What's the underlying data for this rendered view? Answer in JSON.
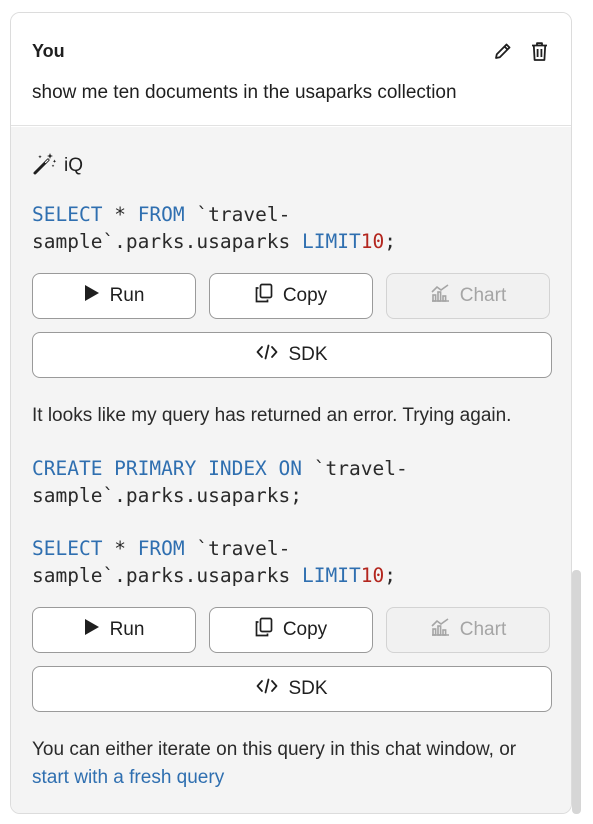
{
  "user": {
    "name": "You",
    "message": "show me ten documents in the usaparks collection"
  },
  "assistant": {
    "name": "iQ",
    "query1": {
      "kw1": "SELECT",
      "star": " * ",
      "kw2": "FROM",
      "rest_line1": " `travel-",
      "line2": "sample`.parks.usaparks ",
      "kw3": "LIMIT",
      "num": "10",
      "end": ";"
    },
    "buttons1": {
      "run": "Run",
      "copy": "Copy",
      "chart": "Chart",
      "sdk": "SDK"
    },
    "error_text": "It looks like my query has returned an error. Trying again.",
    "query2": {
      "kw1": "CREATE PRIMARY INDEX ON",
      "rest_line1": " `travel-",
      "line2": "sample`.parks.usaparks;"
    },
    "query3": {
      "kw1": "SELECT",
      "star": " * ",
      "kw2": "FROM",
      "rest_line1": " `travel-",
      "line2": "sample`.parks.usaparks ",
      "kw3": "LIMIT",
      "num": "10",
      "end": ";"
    },
    "buttons2": {
      "run": "Run",
      "copy": "Copy",
      "chart": "Chart",
      "sdk": "SDK"
    },
    "footer_text": "You can either iterate on this query in this chat window, or",
    "footer_link": "start with a fresh query"
  },
  "colors": {
    "keyword": "#2f6fb0",
    "number": "#b3261e",
    "link": "#2f6fb0",
    "panel_bg": "#f4f4f4"
  },
  "icons": [
    "pencil-icon",
    "trash-icon",
    "magic-wand-icon",
    "play-icon",
    "copy-icon",
    "chart-icon",
    "code-icon"
  ]
}
